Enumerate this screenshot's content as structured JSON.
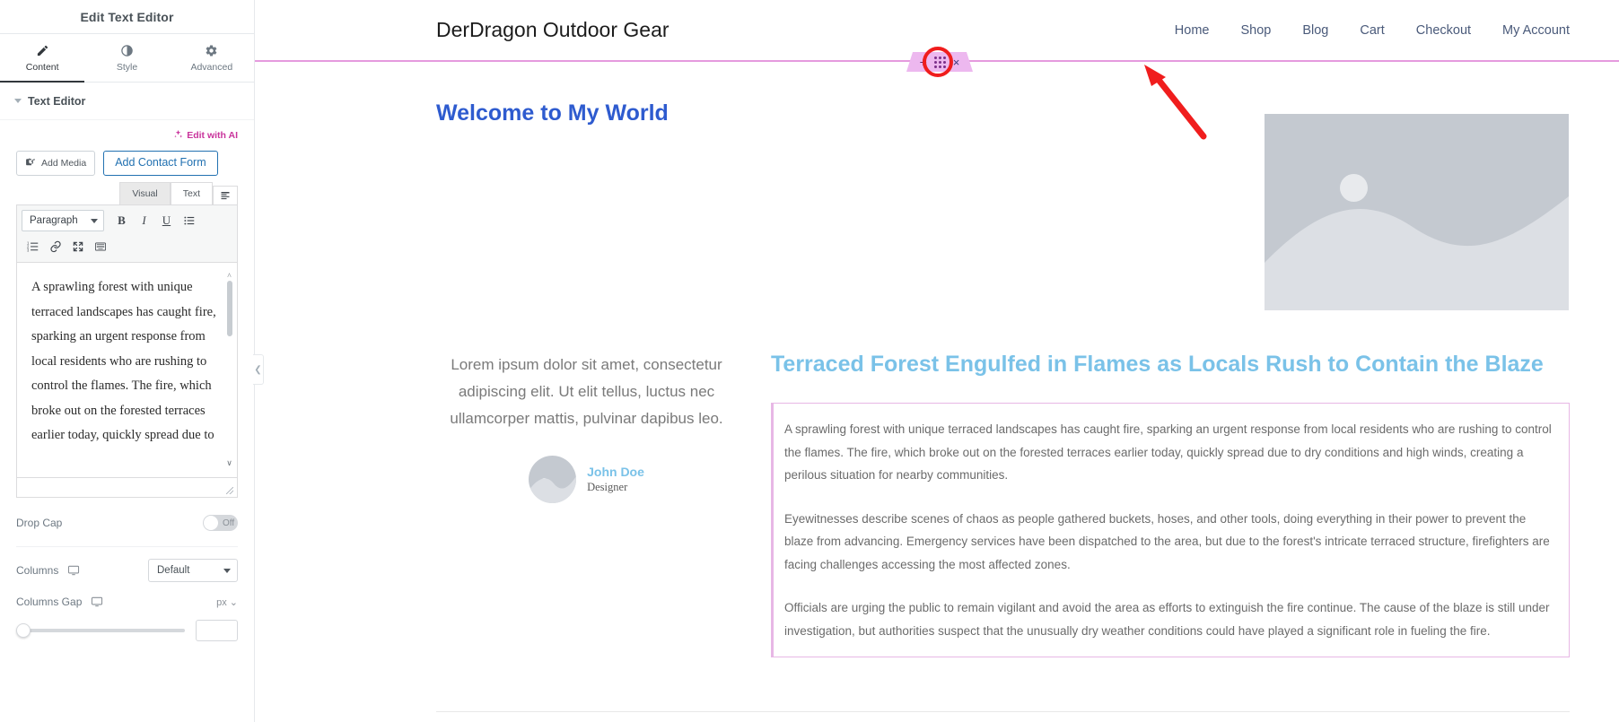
{
  "panel": {
    "title": "Edit Text Editor",
    "tabs": [
      {
        "label": "Content",
        "icon": "pencil-icon",
        "active": true
      },
      {
        "label": "Style",
        "icon": "contrast-icon",
        "active": false
      },
      {
        "label": "Advanced",
        "icon": "gear-icon",
        "active": false
      }
    ],
    "section": {
      "label": "Text Editor"
    },
    "edit_with_ai": "Edit with AI",
    "buttons": {
      "add_media": "Add Media",
      "add_contact_form": "Add Contact Form"
    },
    "mode_tabs": [
      {
        "label": "Visual",
        "active": true
      },
      {
        "label": "Text",
        "active": false
      }
    ],
    "toolbar": {
      "format_select": "Paragraph",
      "row1": [
        "bold-icon",
        "italic-icon",
        "underline-icon",
        "bulleted-list-icon"
      ],
      "row2": [
        "numbered-list-icon",
        "link-icon",
        "fullscreen-icon",
        "toolbar-toggle-icon"
      ]
    },
    "editor_content": "A sprawling forest with unique terraced landscapes has caught fire, sparking an urgent response from local residents who are rushing to control the flames. The fire, which broke out on the forested terraces earlier today, quickly spread due to",
    "controls": {
      "drop_cap_label": "Drop Cap",
      "drop_cap_value": "Off",
      "columns_label": "Columns",
      "columns_value": "Default",
      "columns_gap_label": "Columns Gap",
      "columns_gap_unit": "px",
      "columns_gap_value": ""
    }
  },
  "site": {
    "brand": "DerDragon Outdoor Gear",
    "nav": [
      "Home",
      "Shop",
      "Blog",
      "Cart",
      "Checkout",
      "My Account"
    ],
    "welcome_heading": "Welcome to My World",
    "testimonial": {
      "quote": "Lorem ipsum dolor sit amet, consectetur adipiscing elit. Ut elit tellus, luctus nec ullamcorper mattis, pulvinar dapibus leo.",
      "name": "John Doe",
      "role": "Designer"
    },
    "article": {
      "title": "Terraced Forest Engulfed in Flames as Locals Rush to Contain the Blaze",
      "paragraphs": [
        "A sprawling forest with unique terraced landscapes has caught fire, sparking an urgent response from local residents who are rushing to control the flames. The fire, which broke out on the forested terraces earlier today, quickly spread due to dry conditions and high winds, creating a perilous situation for nearby communities.",
        "Eyewitnesses describe scenes of chaos as people gathered buckets, hoses, and other tools, doing everything in their power to prevent the blaze from advancing. Emergency services have been dispatched to the area, but due to the forest's intricate terraced structure, firefighters are facing challenges accessing the most affected zones.",
        "Officials are urging the public to remain vigilant and avoid the area as efforts to extinguish the fire continue. The cause of the blaze is still under investigation, but authorities suspect that the unusually dry weather conditions could have played a significant role in fueling the fire."
      ]
    },
    "drag_widget": {
      "add": "+",
      "close": "×",
      "handle": "drag-handle-dots"
    }
  },
  "colors": {
    "accent_pink": "#c9349c",
    "link_blue": "#2271b1",
    "heading_blue": "#2e5bcf",
    "article_blue": "#7ac2e8",
    "editor_outline": "#e7b7e5",
    "highlight_red": "#f01d1d"
  }
}
